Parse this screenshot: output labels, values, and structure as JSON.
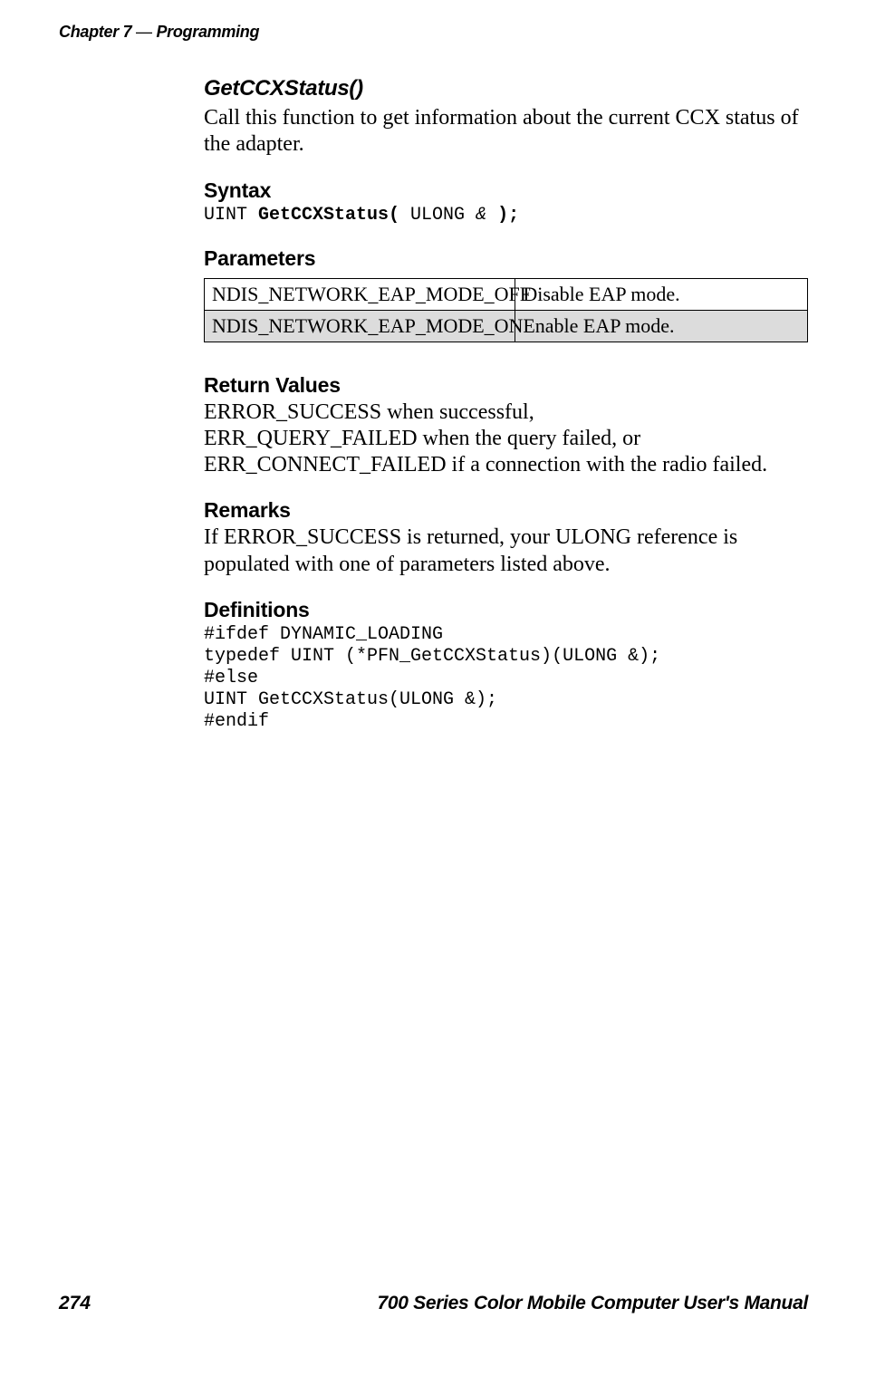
{
  "header": {
    "chapter_label": "Chapter 7",
    "dash": " — ",
    "chapter_title": "Programming"
  },
  "section": {
    "title": "GetCCXStatus()",
    "description": "Call this function to get information about the current CCX status of the adapter."
  },
  "syntax": {
    "heading": "Syntax",
    "line_prefix": "UINT ",
    "line_bold1": "GetCCXStatus(",
    "line_mid": " ULONG ",
    "line_ital": "&",
    "line_bold2": " );"
  },
  "parameters": {
    "heading": "Parameters",
    "rows": [
      {
        "name": "NDIS_NETWORK_EAP_MODE_OFF",
        "desc": "Disable EAP mode."
      },
      {
        "name": "NDIS_NETWORK_EAP_MODE_ON",
        "desc": "Enable EAP mode."
      }
    ]
  },
  "return_values": {
    "heading": "Return Values",
    "line1": "ERROR_SUCCESS when successful,",
    "line2": "ERR_QUERY_FAILED when the query failed, or",
    "line3": "ERR_CONNECT_FAILED if a connection with the radio failed."
  },
  "remarks": {
    "heading": "Remarks",
    "text": "If ERROR_SUCCESS is returned, your ULONG reference is populated with one of parameters listed above."
  },
  "definitions": {
    "heading": "Definitions",
    "code": "#ifdef DYNAMIC_LOADING\ntypedef UINT (*PFN_GetCCXStatus)(ULONG &);\n#else\nUINT GetCCXStatus(ULONG &);\n#endif"
  },
  "footer": {
    "page_number": "274",
    "manual_title": "700 Series Color Mobile Computer User's Manual"
  }
}
